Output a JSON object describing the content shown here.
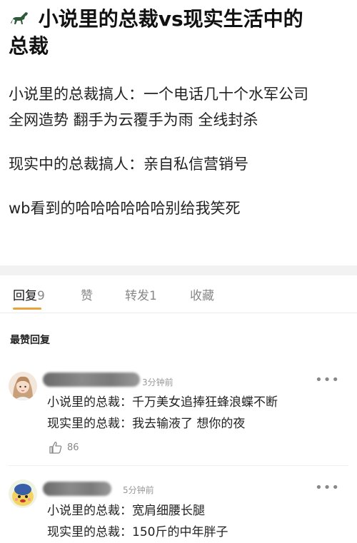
{
  "post": {
    "title_line1": "小说里的总裁vs现实生活中的",
    "title_line2": "总裁",
    "body": [
      "小说里的总裁搞人：一个电话几十个水军公司",
      "全网造势 翻手为云覆手为雨 全线封杀",
      "现实中的总裁搞人：亲自私信营销号",
      "wb看到的哈哈哈哈哈哈别给我笑死"
    ]
  },
  "tabs": [
    {
      "label": "回复",
      "count": "9"
    },
    {
      "label": "赞",
      "count": ""
    },
    {
      "label": "转发",
      "count": "1"
    },
    {
      "label": "收藏",
      "count": ""
    }
  ],
  "section_label": "最赞回复",
  "comments": [
    {
      "time": "3分钟前",
      "lines": [
        "小说里的总裁：千万美女追捧狂蜂浪蝶不断",
        "现实里的总裁：我去输液了 想你的夜"
      ],
      "likes": "86"
    },
    {
      "time": "5分钟前",
      "lines": [
        "小说里的总裁：宽肩细腰长腿",
        "现实里的总裁：150斤的中年胖子"
      ],
      "likes": ""
    }
  ],
  "icons": {
    "title_emoji": "horse-icon",
    "more": "more-dots-icon",
    "like": "thumbs-up-icon"
  },
  "colors": {
    "accent": "#e8a23a"
  }
}
